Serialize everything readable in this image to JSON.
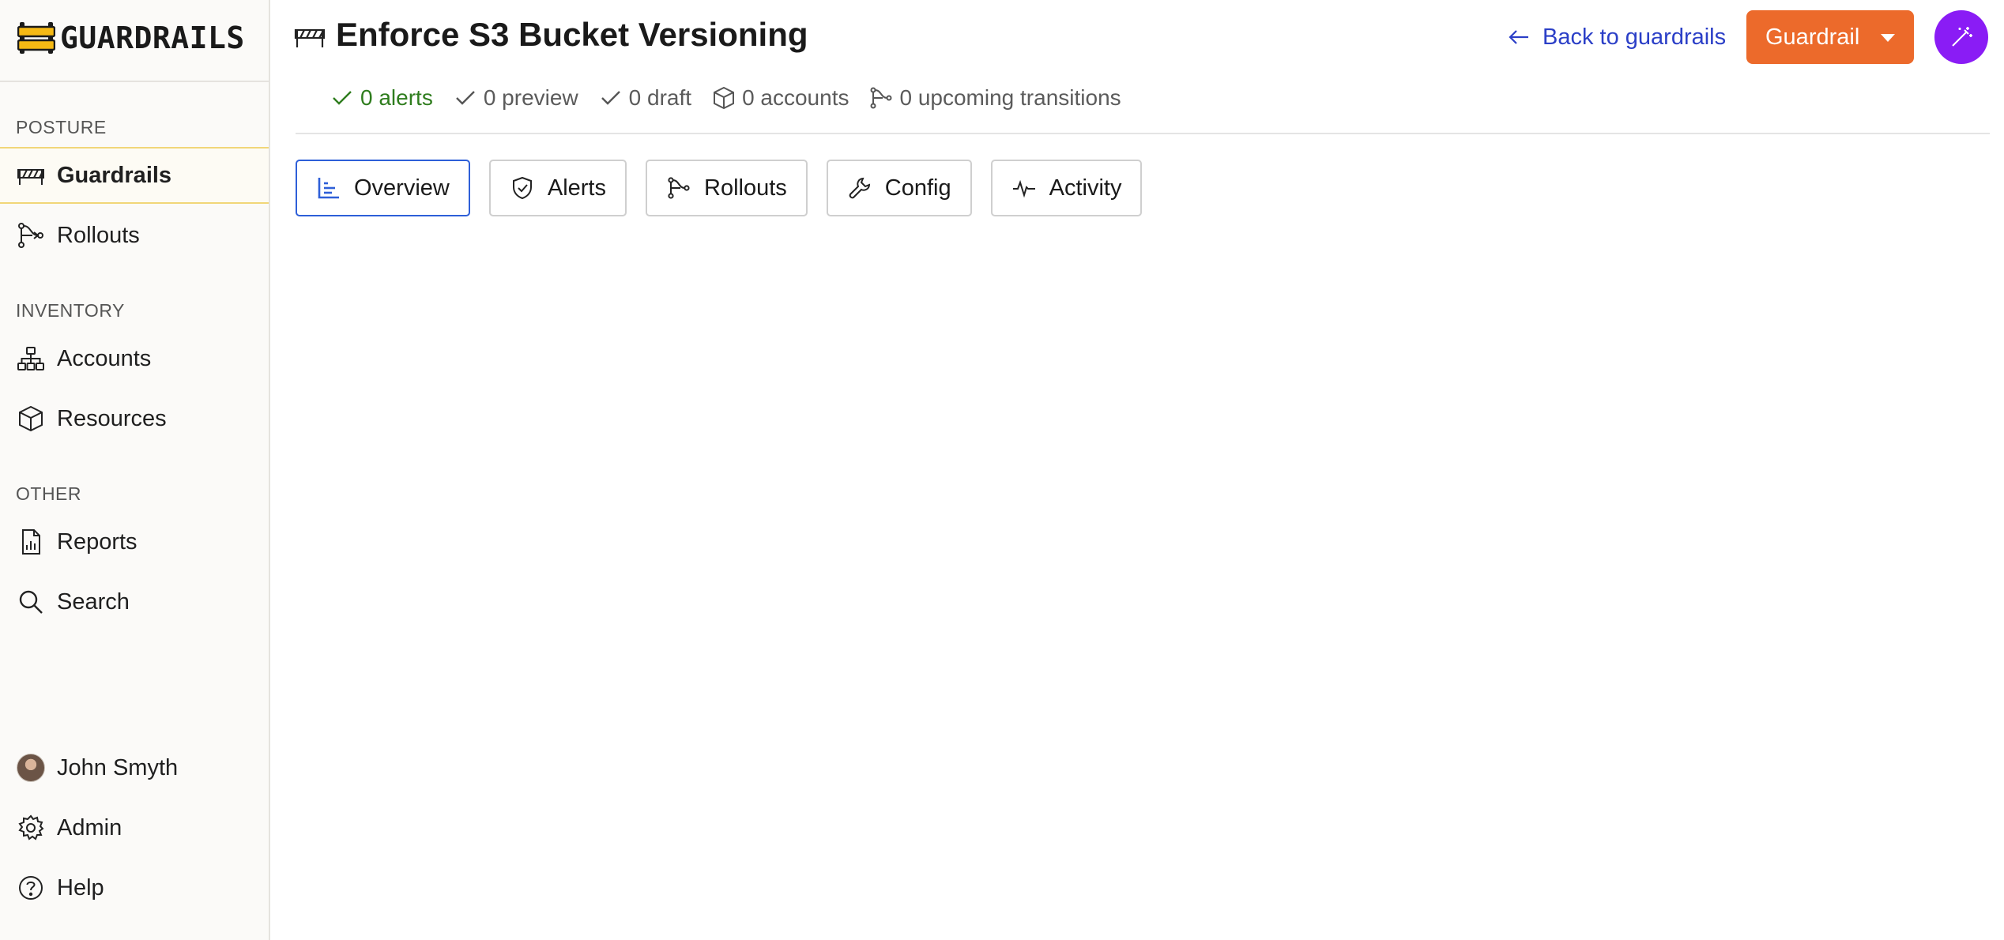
{
  "app": {
    "name": "GUARDRAILS"
  },
  "sidebar": {
    "sections": [
      {
        "label": "POSTURE",
        "items": [
          {
            "label": "Guardrails",
            "icon": "barrier-icon",
            "active": true
          },
          {
            "label": "Rollouts",
            "icon": "rollouts-icon"
          }
        ]
      },
      {
        "label": "INVENTORY",
        "items": [
          {
            "label": "Accounts",
            "icon": "hierarchy-icon"
          },
          {
            "label": "Resources",
            "icon": "cube-icon"
          }
        ]
      },
      {
        "label": "OTHER",
        "items": [
          {
            "label": "Reports",
            "icon": "report-icon"
          },
          {
            "label": "Search",
            "icon": "search-icon"
          }
        ]
      }
    ],
    "footer": [
      {
        "label": "John Smyth",
        "icon": "avatar"
      },
      {
        "label": "Admin",
        "icon": "gear-icon"
      },
      {
        "label": "Help",
        "icon": "help-icon"
      }
    ]
  },
  "header": {
    "title": "Enforce S3 Bucket Versioning",
    "back_label": "Back to guardrails",
    "action_label": "Guardrail"
  },
  "stats": {
    "alerts": "0 alerts",
    "preview": "0 preview",
    "draft": "0 draft",
    "accounts": "0 accounts",
    "transitions": "0 upcoming transitions"
  },
  "tabs": [
    {
      "label": "Overview",
      "icon": "bar-chart-icon",
      "active": true
    },
    {
      "label": "Alerts",
      "icon": "shield-check-icon"
    },
    {
      "label": "Rollouts",
      "icon": "rollouts-icon"
    },
    {
      "label": "Config",
      "icon": "wrench-icon"
    },
    {
      "label": "Activity",
      "icon": "pulse-icon"
    }
  ],
  "colors": {
    "accent_orange": "#ec6a2b",
    "accent_purple": "#8a1cf5",
    "link_blue": "#2b3fc7",
    "success_green": "#2f7d1e",
    "active_highlight": "#f1d679"
  }
}
